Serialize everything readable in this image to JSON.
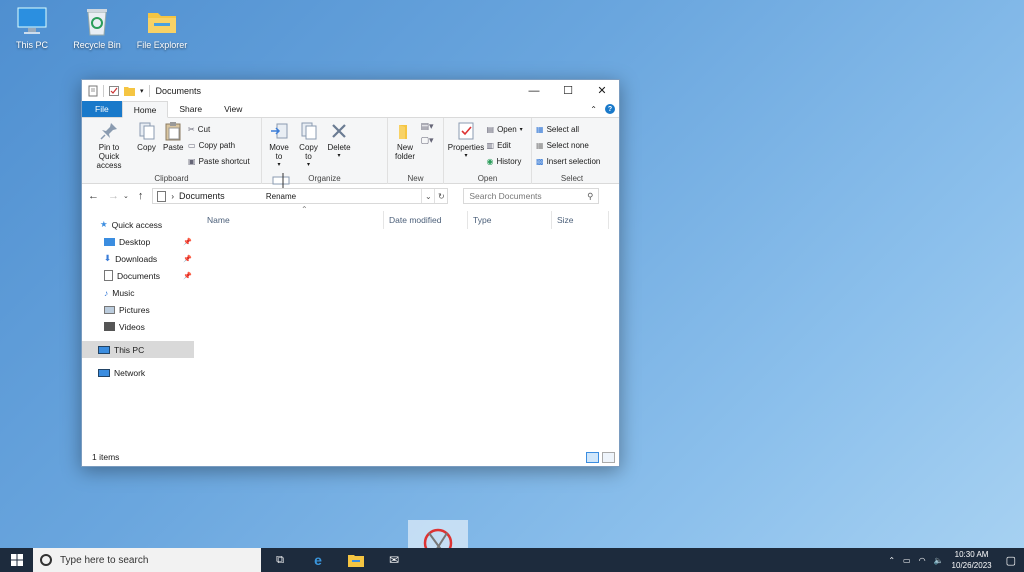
{
  "desktop": {
    "icons": [
      "This PC",
      "Recycle Bin",
      "File Explorer"
    ]
  },
  "window": {
    "title": "Documents",
    "tabs": [
      "File",
      "Home",
      "Share",
      "View"
    ],
    "ribbon": {
      "clipboard": {
        "pin": "Pin to Quick access",
        "copy": "Copy",
        "paste": "Paste",
        "cut": "Cut",
        "copy_path": "Copy path",
        "paste_shortcut": "Paste shortcut",
        "label": "Clipboard"
      },
      "organize": {
        "move_to": "Move to",
        "copy_to": "Copy to",
        "delete": "Delete",
        "rename": "Rename",
        "label": "Organize"
      },
      "new": {
        "new_folder": "New folder",
        "label": "New"
      },
      "open": {
        "properties": "Properties",
        "open": "Open",
        "edit": "Edit",
        "history": "History",
        "label": "Open"
      },
      "select": {
        "select_all": "Select all",
        "select_none": "Select none",
        "invert": "Insert selection",
        "label": "Select"
      }
    },
    "address": {
      "path": "Documents",
      "search_placeholder": "Search Documents"
    },
    "nav": {
      "quick_access": "Quick access",
      "items": [
        "Desktop",
        "Downloads",
        "Documents",
        "Music",
        "Pictures",
        "Videos"
      ],
      "this_pc": "This PC",
      "network": "Network"
    },
    "columns": [
      "Name",
      "Date modified",
      "Type",
      "Size"
    ],
    "status": "1 items"
  },
  "taskbar": {
    "search_placeholder": "Type here to search",
    "time": "10:30 AM",
    "date": "10/26/2023"
  },
  "colors": {
    "accent": "#1979ca",
    "taskbar": "#1d2b3d"
  }
}
